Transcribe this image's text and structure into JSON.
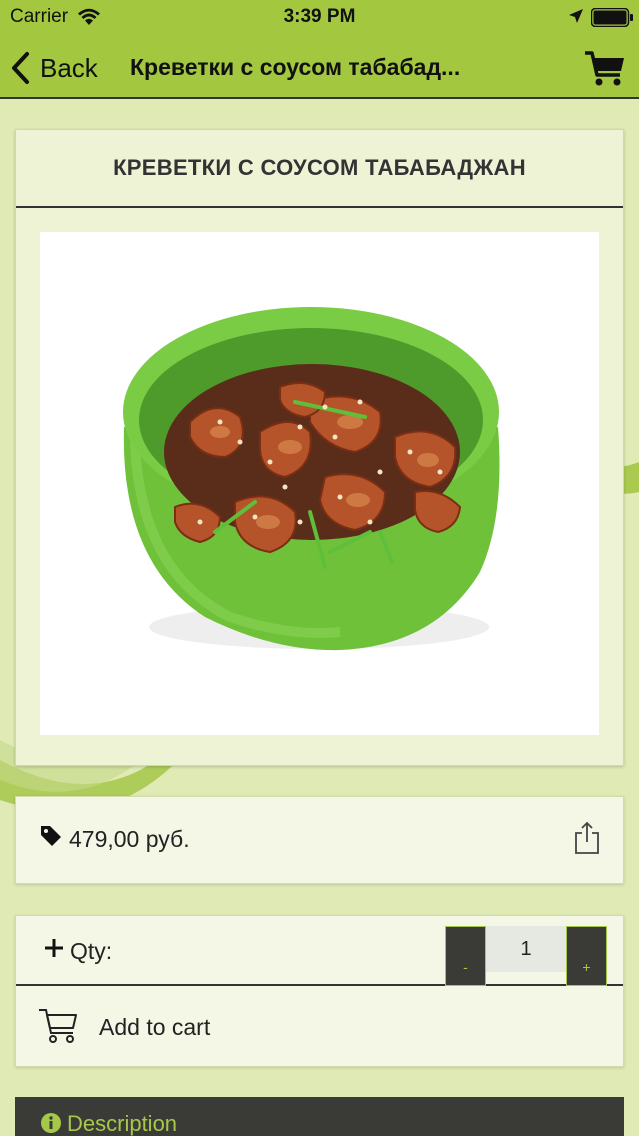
{
  "status_bar": {
    "carrier": "Carrier",
    "time": "3:39 PM",
    "icons": [
      "wifi-icon",
      "location-icon",
      "battery-icon"
    ]
  },
  "nav": {
    "back_label": "Back",
    "title": "Креветки с соусом табабад...",
    "icons": [
      "back-chevron-icon",
      "cart-icon"
    ]
  },
  "product": {
    "heading": "КРЕВЕТКИ С СОУСОМ ТАБАБАДЖАН",
    "image": "shrimp-bowl-photo"
  },
  "price": {
    "text": "479,00 руб.",
    "icons": [
      "price-tag-icon",
      "share-icon"
    ]
  },
  "order": {
    "qty_label": "Qty:",
    "minus_label": "-",
    "qty_value": "1",
    "plus_label": "+",
    "add_to_cart_label": "Add to cart"
  },
  "description": {
    "label": "Description"
  },
  "colors": {
    "accent_green": "#a3c83f",
    "background": "#dfeab4",
    "dark": "#3a3b37",
    "lime_text": "#a6c84a"
  }
}
